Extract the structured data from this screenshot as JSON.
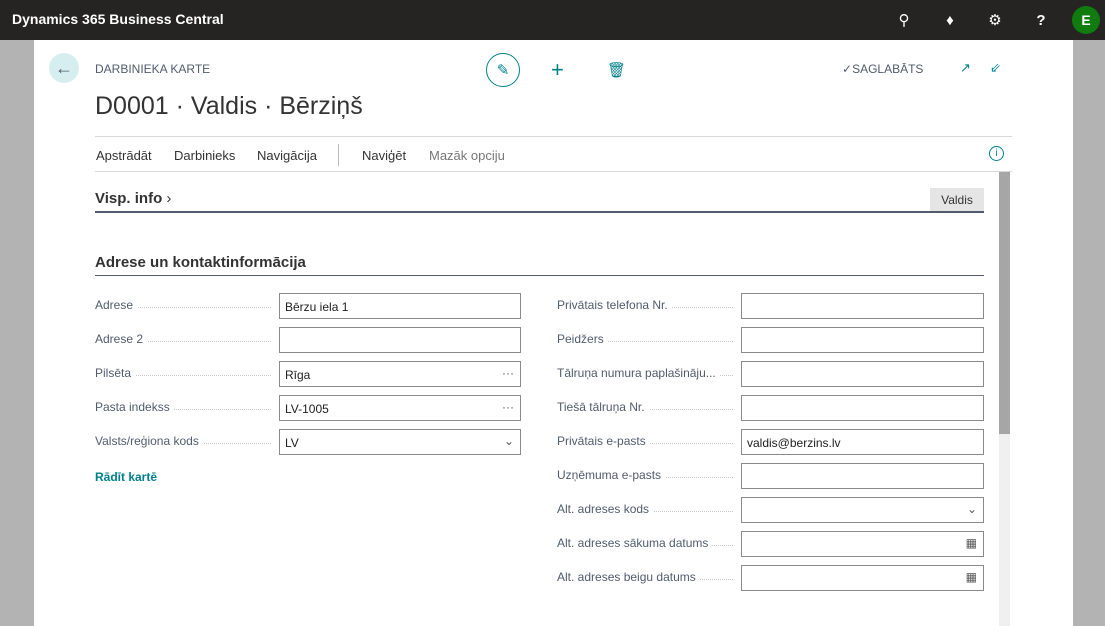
{
  "app": {
    "title": "Dynamics 365 Business Central",
    "user_initial": "E"
  },
  "header": {
    "caption": "DARBINIEKA KARTE",
    "title": "D0001 · Valdis · Bērziņš",
    "status": "SAGLABĀTS"
  },
  "actions": [
    "Apstrādāt",
    "Darbinieks",
    "Navigācija",
    "Naviģēt",
    "Mazāk opciju"
  ],
  "general": {
    "title": "Visp. info",
    "tag": "Valdis"
  },
  "address": {
    "title": "Adrese un kontaktinformācija",
    "show_map": "Rādīt kartē",
    "left": [
      {
        "label": "Adrese",
        "value": "Bērzu iela 1",
        "icon": ""
      },
      {
        "label": "Adrese 2",
        "value": "",
        "icon": ""
      },
      {
        "label": "Pilsēta",
        "value": "Rīga",
        "icon": "ellipsis-icon"
      },
      {
        "label": "Pasta indekss",
        "value": "LV-1005",
        "icon": "ellipsis-icon"
      },
      {
        "label": "Valsts/reģiona kods",
        "value": "LV",
        "icon": "chevron-down-icon"
      }
    ],
    "right": [
      {
        "label": "Privātais telefona Nr.",
        "value": "",
        "icon": ""
      },
      {
        "label": "Peidžers",
        "value": "",
        "icon": ""
      },
      {
        "label": "Tālruņa numura paplašināju...",
        "value": "",
        "icon": ""
      },
      {
        "label": "Tiešā tālruņa Nr.",
        "value": "",
        "icon": ""
      },
      {
        "label": "Privātais e-pasts",
        "value": "valdis@berzins.lv",
        "icon": ""
      },
      {
        "label": "Uzņēmuma e-pasts",
        "value": "",
        "icon": ""
      },
      {
        "label": "Alt. adreses kods",
        "value": "",
        "icon": "chevron-down-icon"
      },
      {
        "label": "Alt. adreses sākuma datums",
        "value": "",
        "icon": "calendar-icon"
      },
      {
        "label": "Alt. adreses beigu datums",
        "value": "",
        "icon": "calendar-icon"
      }
    ]
  },
  "colors": {
    "accent": "#00818a",
    "topbar": "#252423",
    "avatar": "#107c10"
  }
}
